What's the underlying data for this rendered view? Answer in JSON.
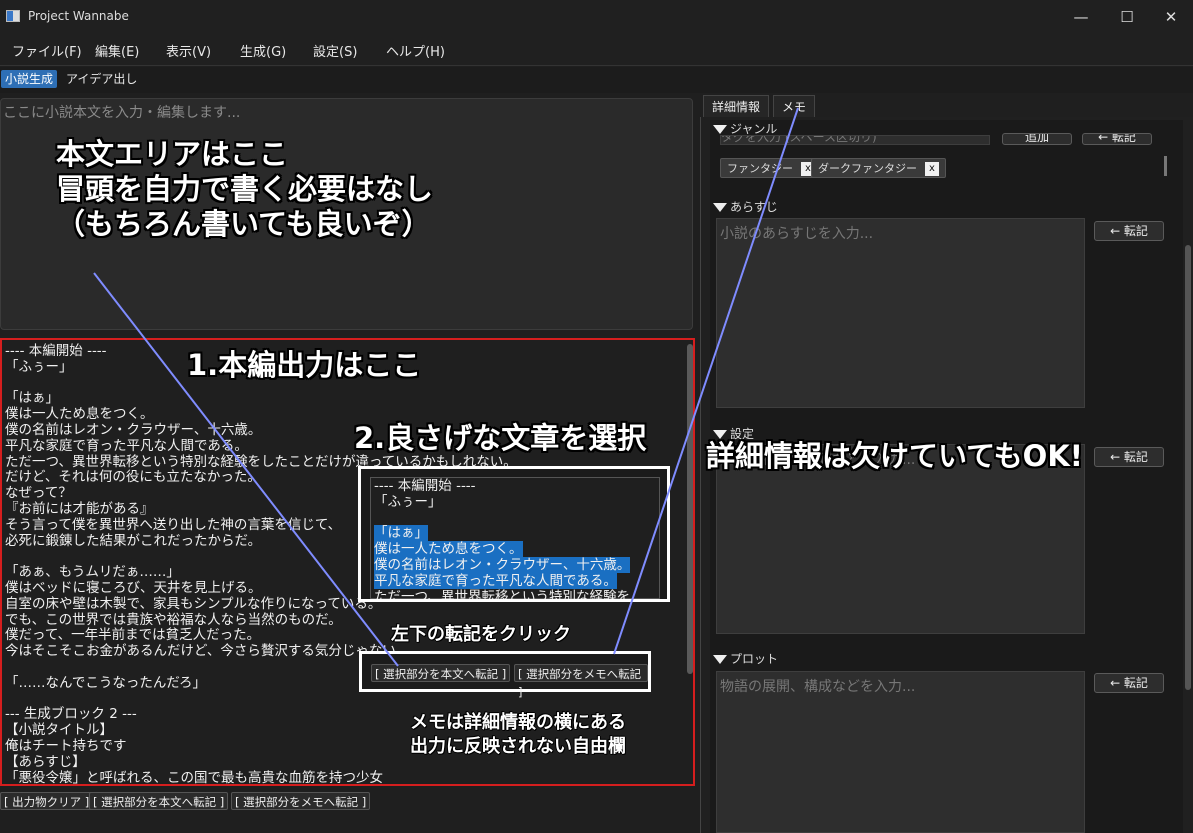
{
  "window": {
    "title": "Project Wannabe",
    "minimize": "—",
    "maximize": "☐",
    "close": "✕"
  },
  "menu": [
    "ファイル(F)",
    "編集(E)",
    "表示(V)",
    "生成(G)",
    "設定(S)",
    "ヘルプ(H)"
  ],
  "modes": [
    {
      "label": "小説生成",
      "active": true
    },
    {
      "label": "アイデア出し",
      "active": false
    }
  ],
  "editor": {
    "placeholder": "ここに小説本文を入力・編集します..."
  },
  "output_lines": [
    "---- 本編開始 ----",
    "「ふぅー」",
    "",
    "「はぁ」",
    "僕は一人ため息をつく。",
    "僕の名前はレオン・クラウザー、十六歳。",
    "平凡な家庭で育った平凡な人間である。",
    "ただ一つ、異世界転移という特別な経験をしたことだけが違っているかもしれない。",
    "だけど、それは何の役にも立たなかった。",
    "なぜって？",
    "『お前には才能がある』",
    "そう言って僕を異世界へ送り出した神の言葉を信じて、",
    "必死に鍛錬した結果がこれだったからだ。",
    "",
    "「あぁ、もうムリだぁ……」",
    "僕はベッドに寝ころび、天井を見上げる。",
    "自室の床や壁は木製で、家具もシンプルな作りになっている。",
    "でも、この世界では貴族や裕福な人なら当然のものだ。",
    "僕だって、一年半前までは貧乏人だった。",
    "今はそこそこお金があるんだけど、今さら贅沢する気分じゃない。",
    "",
    "「……なんでこうなったんだろ」",
    "",
    "--- 生成ブロック 2 ---",
    "【小説タイトル】",
    "俺はチート持ちです",
    "【あらすじ】",
    "「悪役令嬢」と呼ばれる、この国で最も高貴な血筋を持つ少女"
  ],
  "bottom_buttons": [
    "[ 出力物クリア ]",
    "[ 選択部分を本文へ転記 ]",
    "[ 選択部分をメモへ転記 ]"
  ],
  "right_tabs": [
    "詳細情報",
    "メモ"
  ],
  "details": {
    "genre_label": "ジャンル",
    "genre_input_ph": "タグを入力 (スペース区切り)",
    "add_button": "追加",
    "tenki": "← 転記",
    "tags": [
      "ファンタジー",
      "ダークファンタジー"
    ],
    "tag_close": "x",
    "synopsis_label": "あらすじ",
    "synopsis_ph": "小説のあらすじを入力...",
    "setting_label": "設定",
    "setting_ph": "登場人物、世界観などを入力...",
    "plot_label": "プロット",
    "plot_ph": "物語の展開、構成などを入力..."
  },
  "inset": {
    "lines": [
      "---- 本編開始 ----",
      "「ふぅー」",
      "",
      "「はぁ」",
      "僕は一人ため息をつく。",
      "僕の名前はレオン・クラウザー、十六歳。",
      "平凡な家庭で育った平凡な人間である。",
      "ただ一つ、異世界転移という特別な経験を"
    ],
    "btn_to_main": "[ 選択部分を本文へ転記 ]",
    "btn_to_memo": "[ 選択部分をメモへ転記 ]"
  },
  "annotations": {
    "main_area": [
      "本文エリアはここ",
      "冒頭を自力で書く必要はなし",
      "（もちろん書いても良いぞ）"
    ],
    "step1": "1.本編出力はここ",
    "step2": "2.良さげな文章を選択",
    "details_ok": "詳細情報は欠けていてもOK!",
    "click_hint": "左下の転記をクリック",
    "memo_note": [
      "メモは詳細情報の横にある",
      "出力に反映されない自由欄"
    ]
  },
  "colors": {
    "accent": "#2e6fb5",
    "output_border": "#d51e1e",
    "selection": "#1a6fc2",
    "arrow": "#7f8cff"
  }
}
